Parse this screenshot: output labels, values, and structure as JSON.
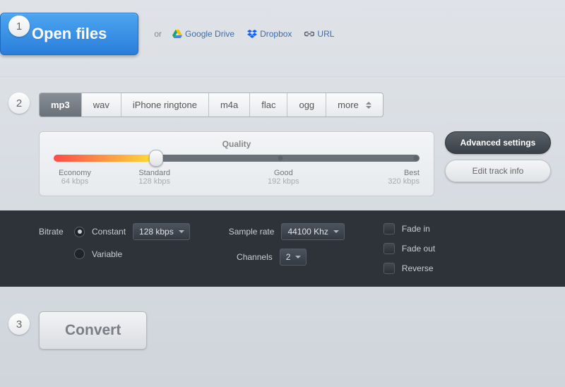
{
  "step1": {
    "num": "1",
    "open": "Open files",
    "or": "or",
    "gdrive": "Google Drive",
    "dropbox": "Dropbox",
    "url": "URL"
  },
  "step2": {
    "num": "2",
    "tabs": {
      "mp3": "mp3",
      "wav": "wav",
      "iphone": "iPhone ringtone",
      "m4a": "m4a",
      "flac": "flac",
      "ogg": "ogg",
      "more": "more"
    },
    "quality_title": "Quality",
    "q": {
      "economy": {
        "n": "Economy",
        "b": "64 kbps"
      },
      "standard": {
        "n": "Standard",
        "b": "128 kbps"
      },
      "good": {
        "n": "Good",
        "b": "192 kbps"
      },
      "best": {
        "n": "Best",
        "b": "320 kbps"
      }
    },
    "adv_settings": "Advanced settings",
    "edit_track": "Edit track info"
  },
  "adv": {
    "bitrate_label": "Bitrate",
    "constant": "Constant",
    "variable": "Variable",
    "bitrate_val": "128 kbps",
    "sample_rate_label": "Sample rate",
    "sample_rate_val": "44100 Khz",
    "channels_label": "Channels",
    "channels_val": "2",
    "fade_in": "Fade in",
    "fade_out": "Fade out",
    "reverse": "Reverse"
  },
  "step3": {
    "num": "3",
    "convert": "Convert"
  }
}
